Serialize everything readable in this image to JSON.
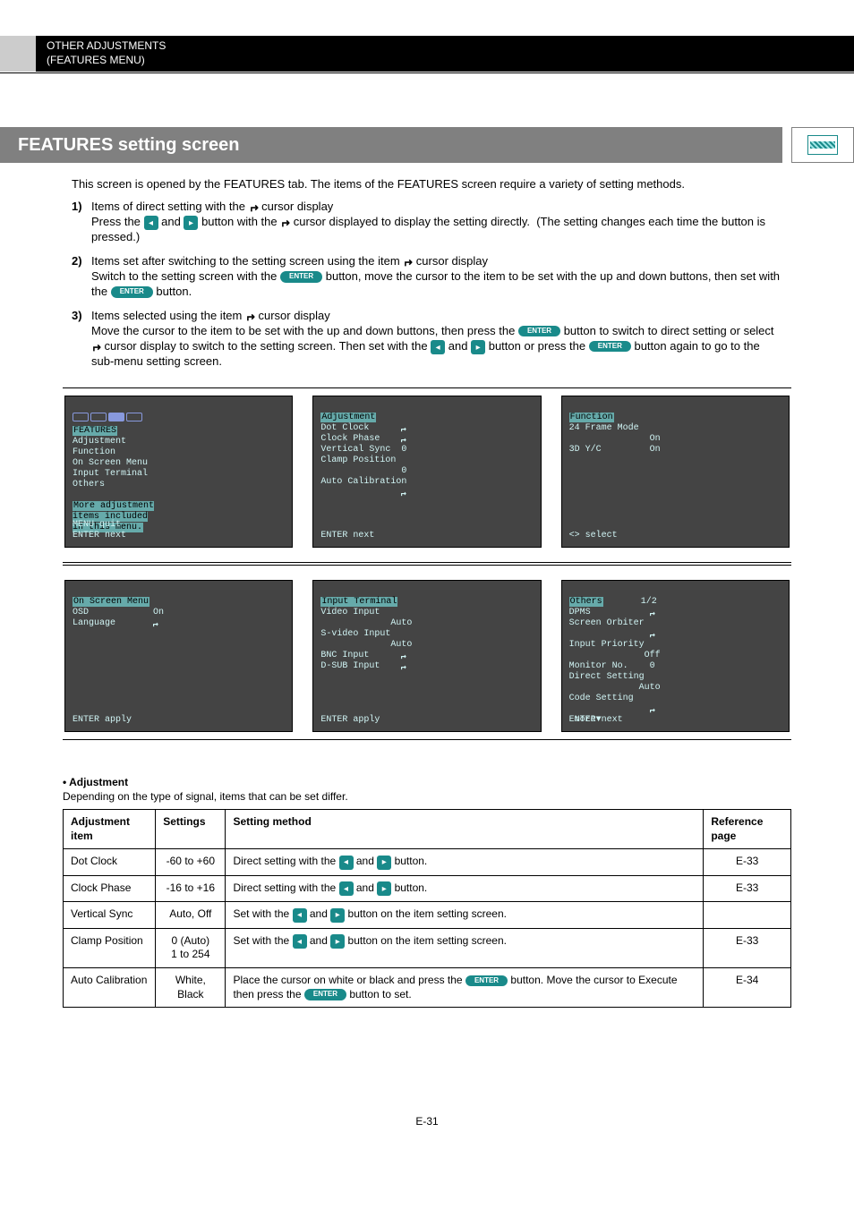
{
  "header": {
    "line1": "OTHER ADJUSTMENTS",
    "line2": "(FEATURES MENU)"
  },
  "section": {
    "title": "FEATURES setting screen"
  },
  "intro": {
    "lead": "This screen is opened by the FEATURES tab. The items of the FEATURES screen require a variety of setting methods.",
    "items": [
      "Items of direct setting with the ↲ cursor display",
      "Press the left and right button with the ↲ cursor displayed to display the setting directly.  (The setting changes each time the button is pressed.)",
      "Items set after switching to the setting screen using the item ↲ cursor display",
      "Switch to the setting screen with the ENTER button, move the cursor to the item to be set with the up and down buttons, then set with the left and right button.",
      "Items selected using the item ↲ cursor display",
      "Move the cursor to the item to be set with the up and down buttons, then press the ENTER button to switch to direct setting or select ↲ cursor display to switch to the setting screen. Then set with the left and right button or press the ENTER button again to go to the sub-menu setting screen."
    ]
  },
  "osd": {
    "features": {
      "title": "FEATURES",
      "items": [
        "Adjustment",
        "Function",
        "On Screen Menu",
        "Input Terminal",
        "Others"
      ],
      "note": "More adjustment\nitems included\nin this menu.",
      "footer": "MENU quit\nENTER next"
    },
    "adjustment": {
      "title": "Adjustment",
      "rows": [
        [
          "Dot Clock",
          "↲"
        ],
        [
          "Clock Phase",
          "↲"
        ],
        [
          "Vertical Sync",
          "0"
        ],
        [
          "Clamp Position",
          "0"
        ]
      ],
      "extra": "Auto Calibration↲",
      "footer": "ENTER next"
    },
    "function": {
      "title": "Function",
      "rows": [
        [
          "24 Frame Mode",
          "On"
        ],
        [
          "3D Y/C",
          "On"
        ]
      ],
      "footer": "<> select"
    },
    "osmenu": {
      "title": "On Screen Menu",
      "rows": [
        [
          "OSD",
          "On"
        ],
        [
          "Language",
          "↲"
        ]
      ],
      "footer": "ENTER apply"
    },
    "inputterm": {
      "title": "Input Terminal",
      "rows": [
        [
          "Video Input",
          "Auto"
        ],
        [
          "S-video Input",
          "Auto"
        ],
        [
          "BNC Input",
          "↲"
        ],
        [
          "D-SUB Input",
          "↲"
        ]
      ],
      "footer": "ENTER apply"
    },
    "others": {
      "title": "Others",
      "page": "1/2",
      "rows": [
        [
          "DPMS",
          "↲"
        ],
        [
          "Screen Orbiter",
          "↲"
        ],
        [
          "Input Priority",
          "Off"
        ],
        [
          "Monitor No.",
          "0",
          ""
        ],
        [
          "Direct Setting",
          "Auto"
        ],
        [
          "Code Setting",
          "↲"
        ]
      ],
      "more": "more▼",
      "footer": "ENTER next"
    }
  },
  "tableIntro": "Depending on the type of signal, items that can be set differ.",
  "table": {
    "headers": [
      "Adjustment item",
      "Settings",
      "Setting method",
      "Reference page"
    ],
    "rows": [
      {
        "item": "Dot Clock",
        "settings": "-60 to +60",
        "method": "Direct setting with the left and right button.",
        "ref": "E-33"
      },
      {
        "item": "Clock Phase",
        "settings": "-16 to +16",
        "method": "Direct setting with the left and right button.",
        "ref": "E-33"
      },
      {
        "item": "Vertical Sync",
        "settings": "Auto, Off",
        "method": "Set with the left and right button on the item setting screen.",
        "ref": ""
      },
      {
        "item": "Clamp Position",
        "settings": "0 (Auto)\n1 to 254",
        "method": "Set with the left and right button on the item setting screen.",
        "ref": "E-33"
      },
      {
        "item": "Auto Calibration",
        "settings": "White, Black",
        "method": "Place the cursor on white or black and press the ENTER button. Move the cursor to Execute then press the ENTER button to set.",
        "ref": "E-34"
      }
    ]
  },
  "pageNumber": "E-31"
}
